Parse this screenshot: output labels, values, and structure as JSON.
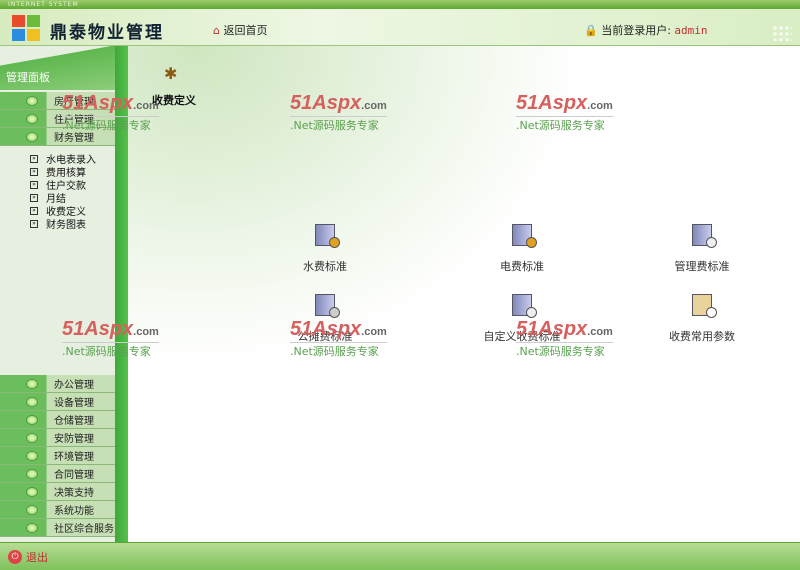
{
  "header": {
    "system_tag": "INTERNET SYSTEM",
    "app_title": "鼎泰物业管理",
    "home_link": "返回首页",
    "user_label": "当前登录用户:",
    "username": "admin"
  },
  "sidebar": {
    "title": "管理面板",
    "top_menu": [
      {
        "label": "房产管理"
      },
      {
        "label": "住户管理"
      },
      {
        "label": "财务管理"
      }
    ],
    "submenu": [
      {
        "label": "水电表录入"
      },
      {
        "label": "费用核算"
      },
      {
        "label": "住户交款"
      },
      {
        "label": "月结"
      },
      {
        "label": "收费定义"
      },
      {
        "label": "财务图表"
      }
    ],
    "bottom_menu": [
      {
        "label": "办公管理"
      },
      {
        "label": "设备管理"
      },
      {
        "label": "仓储管理"
      },
      {
        "label": "安防管理"
      },
      {
        "label": "环境管理"
      },
      {
        "label": "合同管理"
      },
      {
        "label": "决策支持"
      },
      {
        "label": "系统功能"
      },
      {
        "label": "社区综合服务"
      }
    ]
  },
  "content": {
    "page_title": "收费定义",
    "items": [
      {
        "label": "水费标准"
      },
      {
        "label": "电费标准"
      },
      {
        "label": "管理费标准"
      },
      {
        "label": "公摊费标准"
      },
      {
        "label": "自定义收费标准"
      },
      {
        "label": "收费常用参数"
      }
    ]
  },
  "watermark": {
    "brand": "51Aspx",
    "domain": ".com",
    "tagline": ".Net源码服务专家"
  },
  "footer": {
    "logout": "退出"
  }
}
